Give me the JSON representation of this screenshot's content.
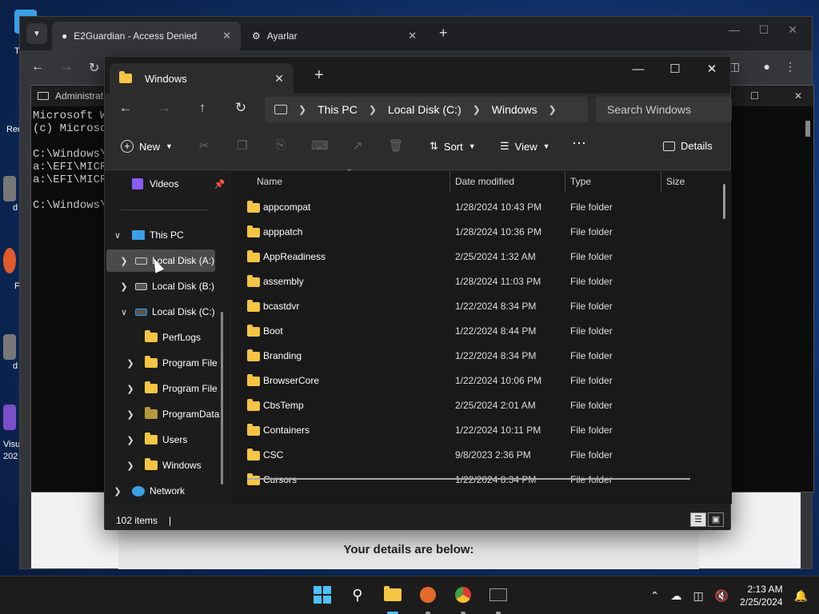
{
  "desktop": {
    "labels": [
      "T",
      "Rec",
      "d",
      "F",
      "d",
      "Visu",
      "202"
    ]
  },
  "chrome": {
    "tabs": [
      {
        "label": "E2Guardian - Access Denied",
        "active": true
      },
      {
        "label": "Ayarlar",
        "active": false
      }
    ],
    "page_text": "Your details are below:"
  },
  "cmd": {
    "title": "Administrat",
    "lines": [
      "Microsoft Wi",
      "(c) Microso",
      "",
      "C:\\Windows\\S",
      "a:\\EFI\\MICRO",
      "a:\\EFI\\MICRO",
      "",
      "C:\\Windows\\S"
    ]
  },
  "explorer": {
    "tab_title": "Windows",
    "breadcrumb": [
      "This PC",
      "Local Disk (C:)",
      "Windows"
    ],
    "search_placeholder": "Search Windows",
    "commands": {
      "new": "New",
      "sort": "Sort",
      "view": "View",
      "details": "Details"
    },
    "nav": {
      "videos": "Videos",
      "this_pc": "This PC",
      "disk_a": "Local Disk (A:)",
      "disk_b": "Local Disk (B:)",
      "disk_c": "Local Disk (C:)",
      "perflogs": "PerfLogs",
      "program_files_1": "Program File",
      "program_files_2": "Program File",
      "programdata": "ProgramData",
      "users": "Users",
      "windows": "Windows",
      "network": "Network"
    },
    "columns": {
      "name": "Name",
      "date": "Date modified",
      "type": "Type",
      "size": "Size"
    },
    "rows": [
      {
        "name": "appcompat",
        "date": "1/28/2024 10:43 PM",
        "type": "File folder"
      },
      {
        "name": "apppatch",
        "date": "1/28/2024 10:36 PM",
        "type": "File folder"
      },
      {
        "name": "AppReadiness",
        "date": "2/25/2024 1:32 AM",
        "type": "File folder"
      },
      {
        "name": "assembly",
        "date": "1/28/2024 11:03 PM",
        "type": "File folder"
      },
      {
        "name": "bcastdvr",
        "date": "1/22/2024 8:34 PM",
        "type": "File folder"
      },
      {
        "name": "Boot",
        "date": "1/22/2024 8:44 PM",
        "type": "File folder"
      },
      {
        "name": "Branding",
        "date": "1/22/2024 8:34 PM",
        "type": "File folder"
      },
      {
        "name": "BrowserCore",
        "date": "1/22/2024 10:06 PM",
        "type": "File folder"
      },
      {
        "name": "CbsTemp",
        "date": "2/25/2024 2:01 AM",
        "type": "File folder"
      },
      {
        "name": "Containers",
        "date": "1/22/2024 10:11 PM",
        "type": "File folder"
      },
      {
        "name": "CSC",
        "date": "9/8/2023 2:36 PM",
        "type": "File folder"
      },
      {
        "name": "Cursors",
        "date": "1/22/2024 8:34 PM",
        "type": "File folder"
      }
    ],
    "status": "102 items"
  },
  "taskbar": {
    "time": "2:13 AM",
    "date": "2/25/2024"
  }
}
